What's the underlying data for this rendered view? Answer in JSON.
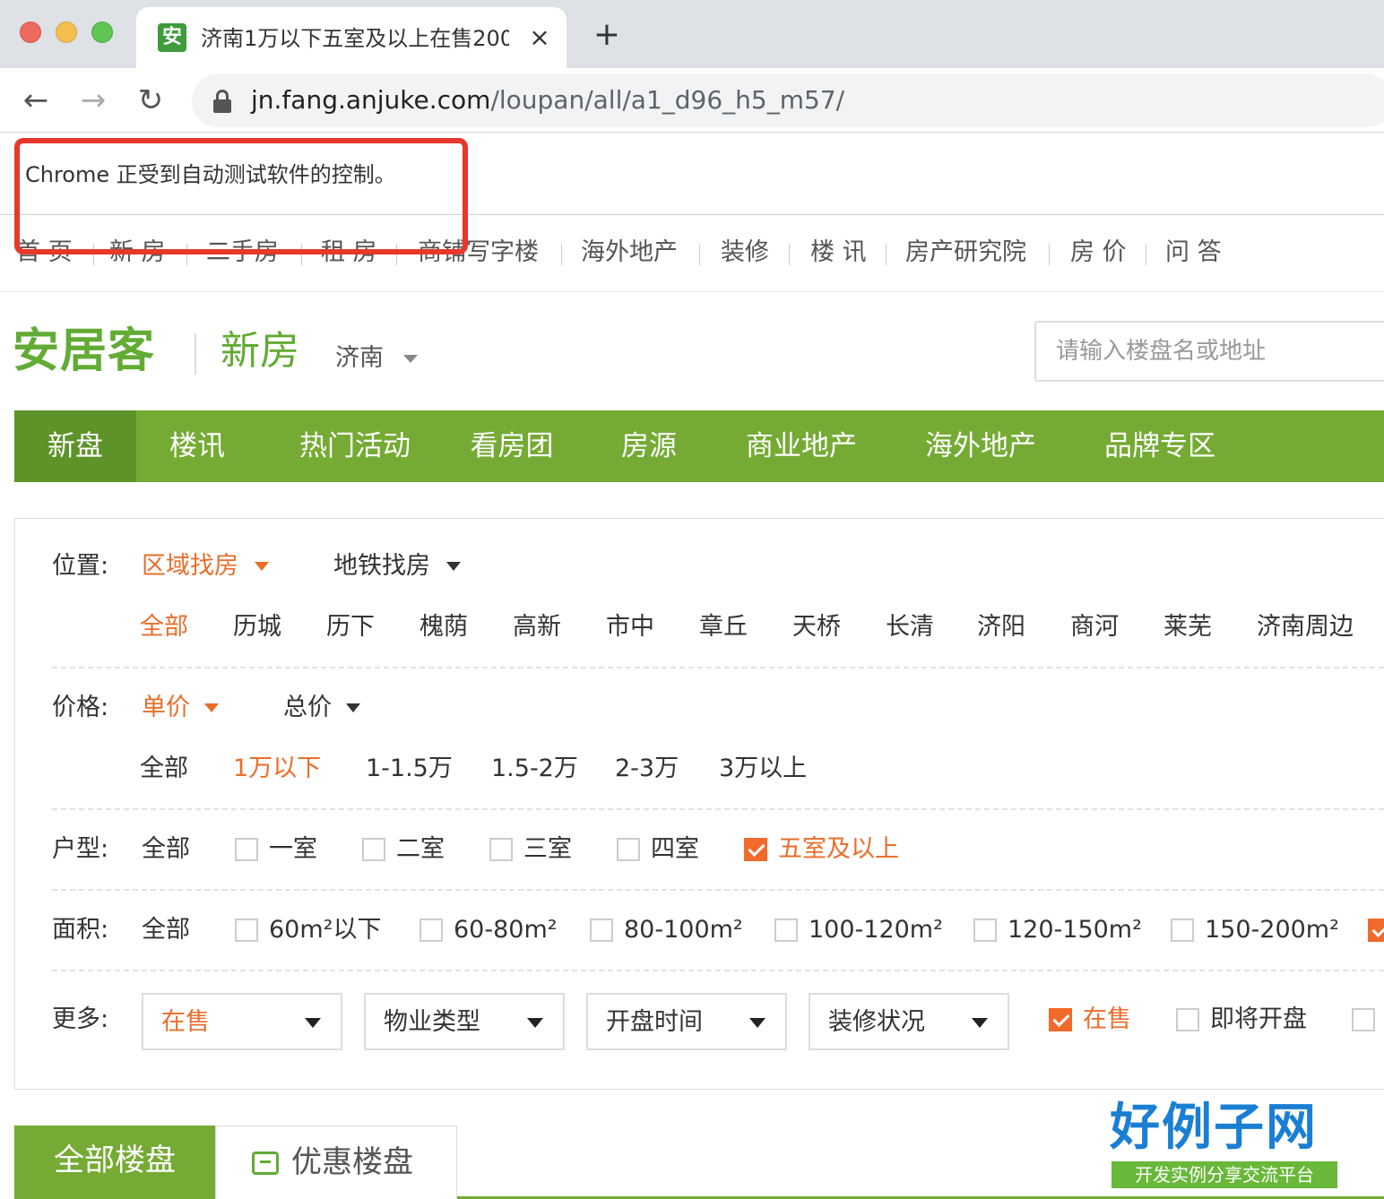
{
  "browser": {
    "tab_title": "济南1万以下五室及以上在售200",
    "tab_close": "×",
    "new_tab": "+",
    "url_host": "jn.fang.anjuke.com",
    "url_path": "/loupan/all/a1_d96_h5_m57/",
    "infobar_text": "Chrome 正受到自动测试软件的控制。",
    "back_glyph": "←",
    "forward_glyph": "→",
    "reload_glyph": "↻",
    "favicon_glyph": "安"
  },
  "topnav": [
    "首 页",
    "新 房",
    "二手房",
    "租 房",
    "商铺写字楼",
    "海外地产",
    "装修",
    "楼 讯",
    "房产研究院",
    "房 价",
    "问 答"
  ],
  "header": {
    "logo": "安居客",
    "logo_sub": "新房",
    "city": "济南",
    "search_placeholder": "请输入楼盘名或地址"
  },
  "mainnav": [
    "新盘",
    "楼讯",
    "热门活动",
    "看房团",
    "房源",
    "商业地产",
    "海外地产",
    "品牌专区"
  ],
  "filters": {
    "location": {
      "label": "位置:",
      "modes": [
        "区域找房",
        "地铁找房"
      ],
      "areas": [
        "全部",
        "历城",
        "历下",
        "槐荫",
        "高新",
        "市中",
        "章丘",
        "天桥",
        "长清",
        "济阳",
        "商河",
        "莱芜",
        "济南周边"
      ]
    },
    "price": {
      "label": "价格:",
      "modes": [
        "单价",
        "总价"
      ],
      "options": [
        "全部",
        "1万以下",
        "1-1.5万",
        "1.5-2万",
        "2-3万",
        "3万以上"
      ]
    },
    "rooms": {
      "label": "户型:",
      "all": "全部",
      "options": [
        "一室",
        "二室",
        "三室",
        "四室",
        "五室及以上"
      ]
    },
    "area": {
      "label": "面积:",
      "all": "全部",
      "options": [
        "60m²以下",
        "60-80m²",
        "80-100m²",
        "100-120m²",
        "120-150m²",
        "150-200m²"
      ]
    },
    "more": {
      "label": "更多:",
      "selects": [
        "在售",
        "物业类型",
        "开盘时间",
        "装修状况"
      ],
      "checks": [
        "在售",
        "即将开盘"
      ]
    }
  },
  "tabs": {
    "all": "全部楼盘",
    "deals": "优惠楼盘"
  },
  "watermark": {
    "big": "好例子网",
    "small": "开发实例分享交流平台"
  },
  "colors": {
    "brand_green": "#75ab34",
    "active_orange": "#e96d2a",
    "annotation_red": "#e8372b"
  }
}
